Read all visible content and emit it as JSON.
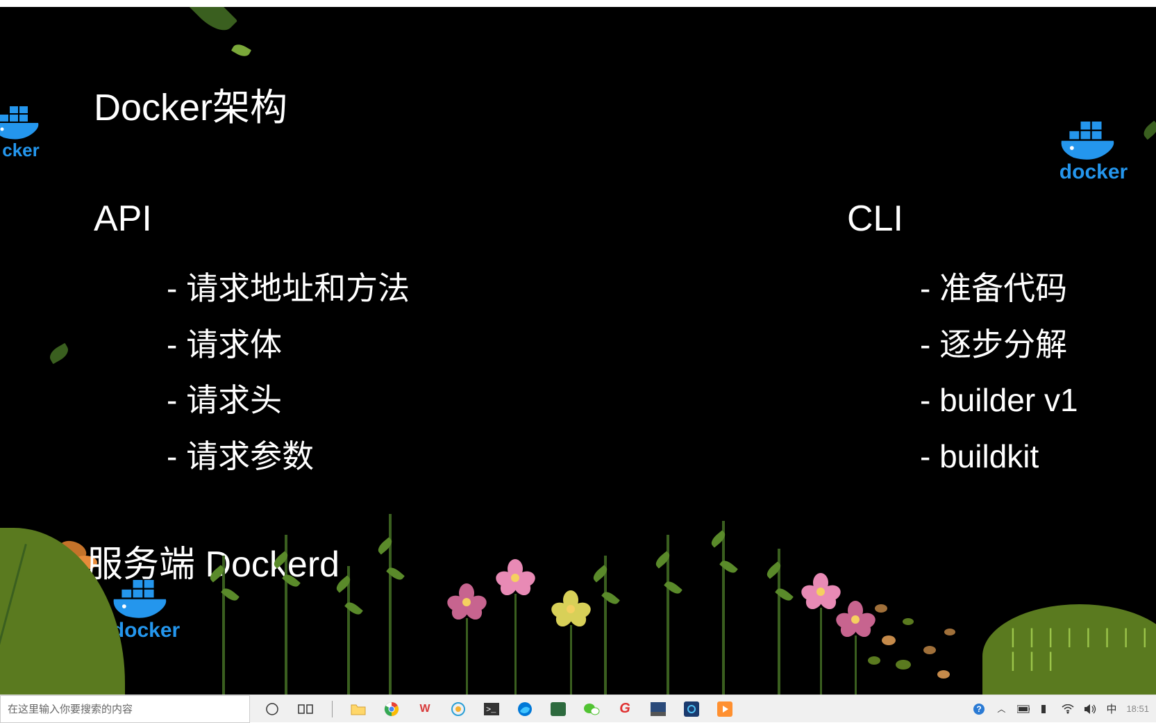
{
  "slide": {
    "title": "Docker架构",
    "sections": {
      "api": {
        "header": "API",
        "items": [
          "- 请求地址和方法",
          "- 请求体",
          "- 请求头",
          "- 请求参数"
        ]
      },
      "cli": {
        "header": "CLI",
        "items": [
          "- 准备代码",
          "- 逐步分解",
          "- builder v1",
          "- buildkit"
        ]
      }
    },
    "subtitle": "服务端 Dockerd",
    "docker_label": "docker",
    "docker_label_partial": "cker"
  },
  "taskbar": {
    "search_placeholder": "在这里输入你要搜索的内容",
    "ime_label": "中",
    "time": "18:51"
  }
}
